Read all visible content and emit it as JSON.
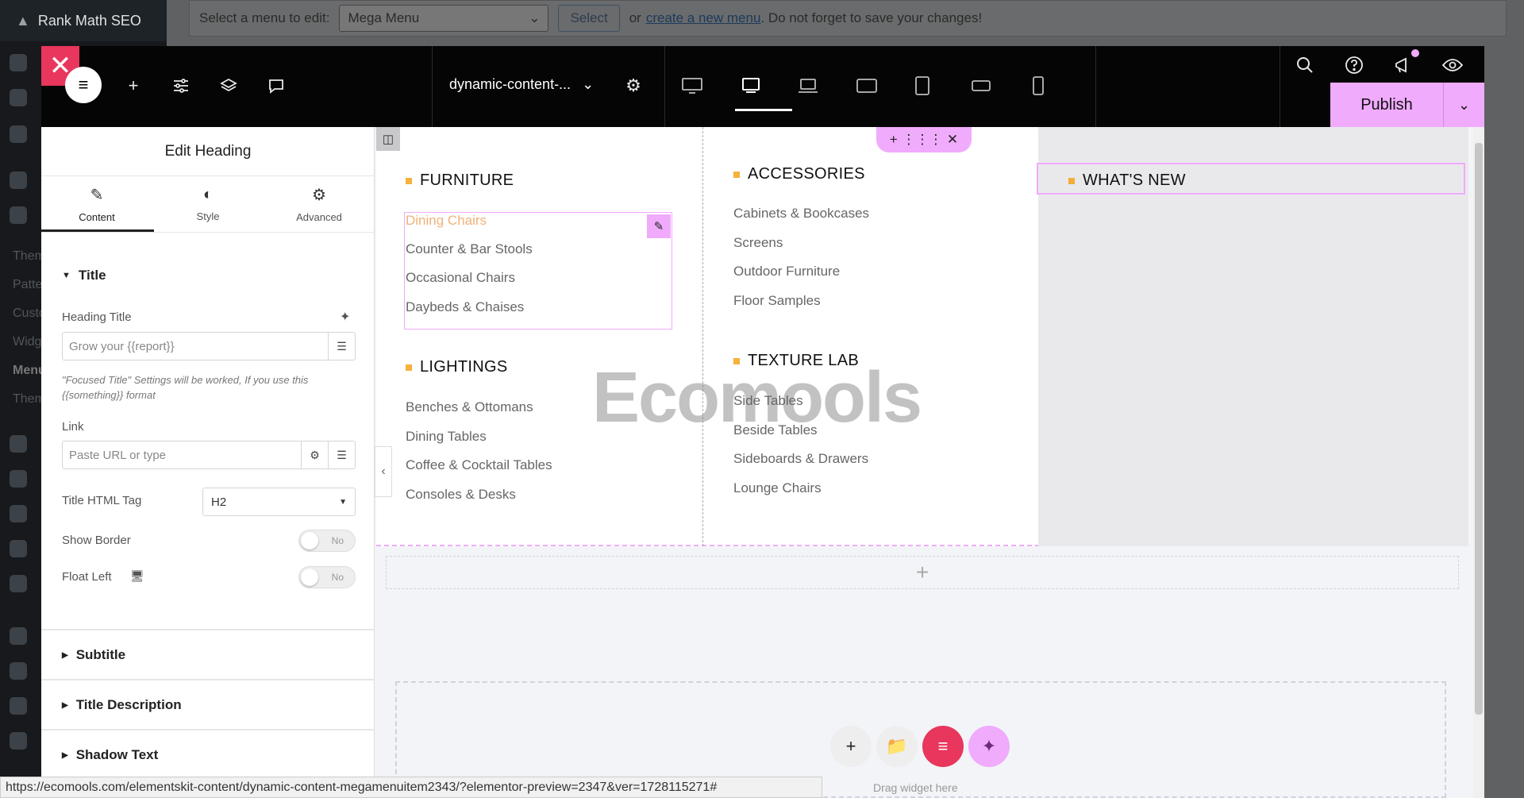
{
  "wp": {
    "brand": "Rank Math SEO",
    "menu_prompt": "Select a menu to edit:",
    "menu_selected": "Mega Menu",
    "select_button": "Select",
    "or_text": "or",
    "create_link": "create a new menu",
    "save_note": ". Do not forget to save your changes!",
    "sidebar_labels": [
      "Them",
      "Patte",
      "Custo",
      "Widg",
      "Menu",
      "Them"
    ]
  },
  "topbar": {
    "document_title": "dynamic-content-...",
    "publish_label": "Publish"
  },
  "panel": {
    "title": "Edit Heading",
    "tabs": [
      {
        "label": "Content",
        "icon": "pencil-icon"
      },
      {
        "label": "Style",
        "icon": "contrast-icon"
      },
      {
        "label": "Advanced",
        "icon": "gear-icon"
      }
    ],
    "title_section": "Title",
    "heading_title_label": "Heading Title",
    "heading_title_value": "Grow your {{report}}",
    "hint": "\"Focused Title\" Settings will be worked, If you use this {{something}} format",
    "link_label": "Link",
    "link_placeholder": "Paste URL or type",
    "html_tag_label": "Title HTML Tag",
    "html_tag_value": "H2",
    "show_border_label": "Show Border",
    "show_border_value": "No",
    "float_left_label": "Float Left",
    "float_left_value": "No",
    "subtitle_section": "Subtitle",
    "title_desc_section": "Title Description",
    "shadow_section": "Shadow Text"
  },
  "mega_menu": {
    "furniture": {
      "heading": "FURNITURE",
      "items": [
        "Dining Chairs",
        "Counter & Bar Stools",
        "Occasional Chairs",
        "Daybeds & Chaises"
      ]
    },
    "lightings": {
      "heading": "LIGHTINGS",
      "items": [
        "Benches & Ottomans",
        "Dining Tables",
        "Coffee & Cocktail Tables",
        "Consoles & Desks"
      ]
    },
    "accessories": {
      "heading": "ACCESSORIES",
      "items": [
        "Cabinets & Bookcases",
        "Screens",
        "Outdoor Furniture",
        "Floor Samples"
      ]
    },
    "texture_lab": {
      "heading": "TEXTURE LAB",
      "items": [
        "Side Tables",
        "Beside Tables",
        "Sideboards & Drawers",
        "Lounge Chairs"
      ]
    },
    "whats_new": {
      "heading": "WHAT'S NEW"
    }
  },
  "canvas": {
    "watermark": "Ecomools",
    "drop_text": "Drag widget here"
  },
  "status_url": "https://ecomools.com/elementskit-content/dynamic-content-megamenuitem2343/?elementor-preview=2347&ver=1728115271#",
  "colors": {
    "accent": "#f0abfc",
    "active_link": "#f0b27a",
    "close": "#e8365d",
    "bullet": "#f59e0b"
  }
}
